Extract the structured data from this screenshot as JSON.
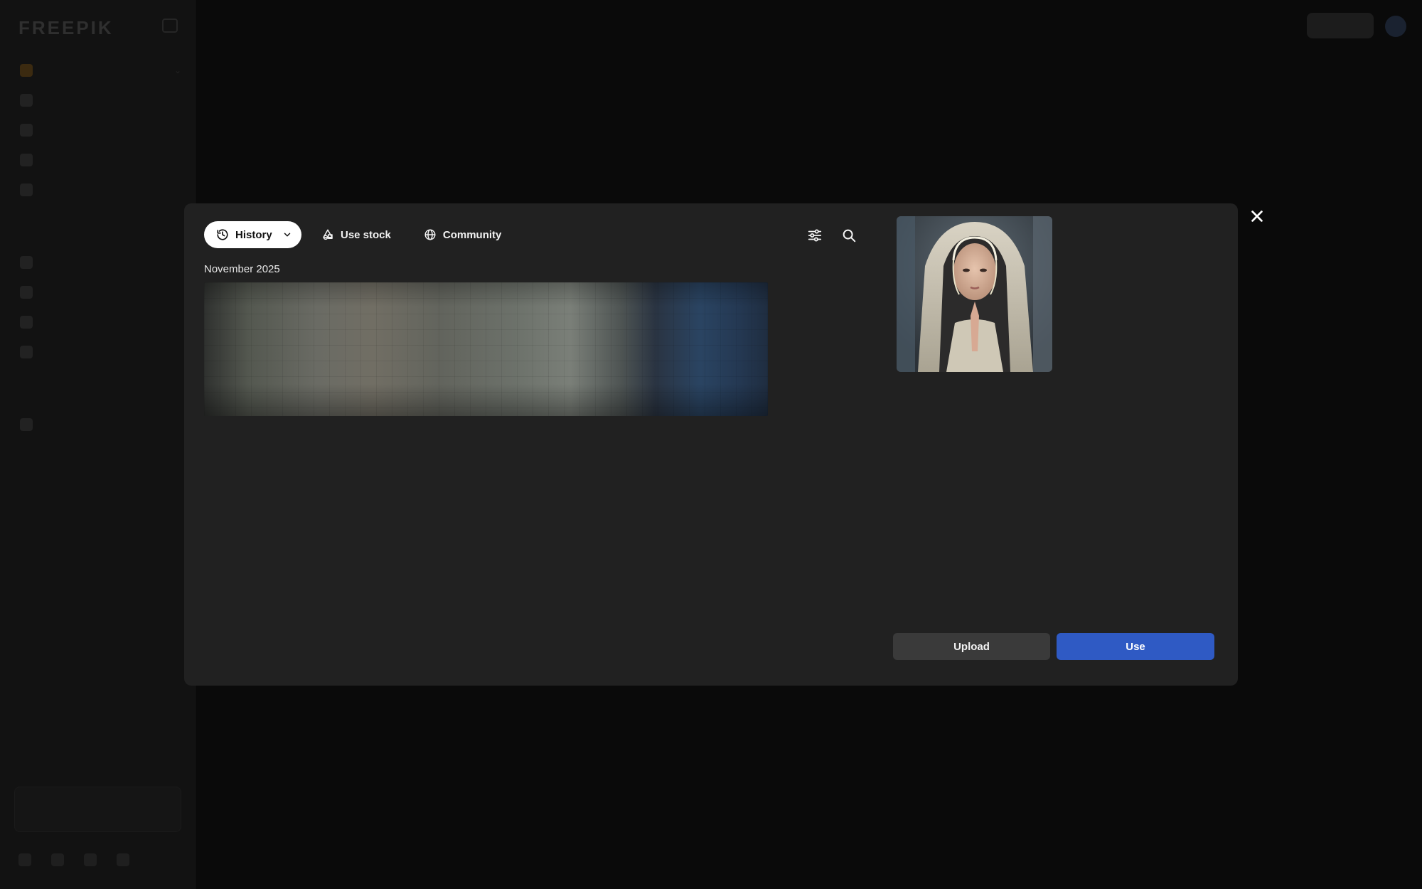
{
  "modal": {
    "tabs": {
      "history_label": "History",
      "stock_label": "Use stock",
      "community_label": "Community"
    },
    "date_group": "November 2025",
    "buttons": {
      "upload_label": "Upload",
      "use_label": "Use"
    },
    "icons": {
      "close": "close-icon",
      "history": "history-icon",
      "chevron": "chevron-down-icon",
      "stock": "stock-icon",
      "community": "globe-icon",
      "filter": "sliders-icon",
      "search": "search-icon"
    },
    "colors": {
      "modal_bg": "#212121",
      "use_button": "#2f5ac4",
      "upload_button": "#3a3a3a"
    }
  }
}
